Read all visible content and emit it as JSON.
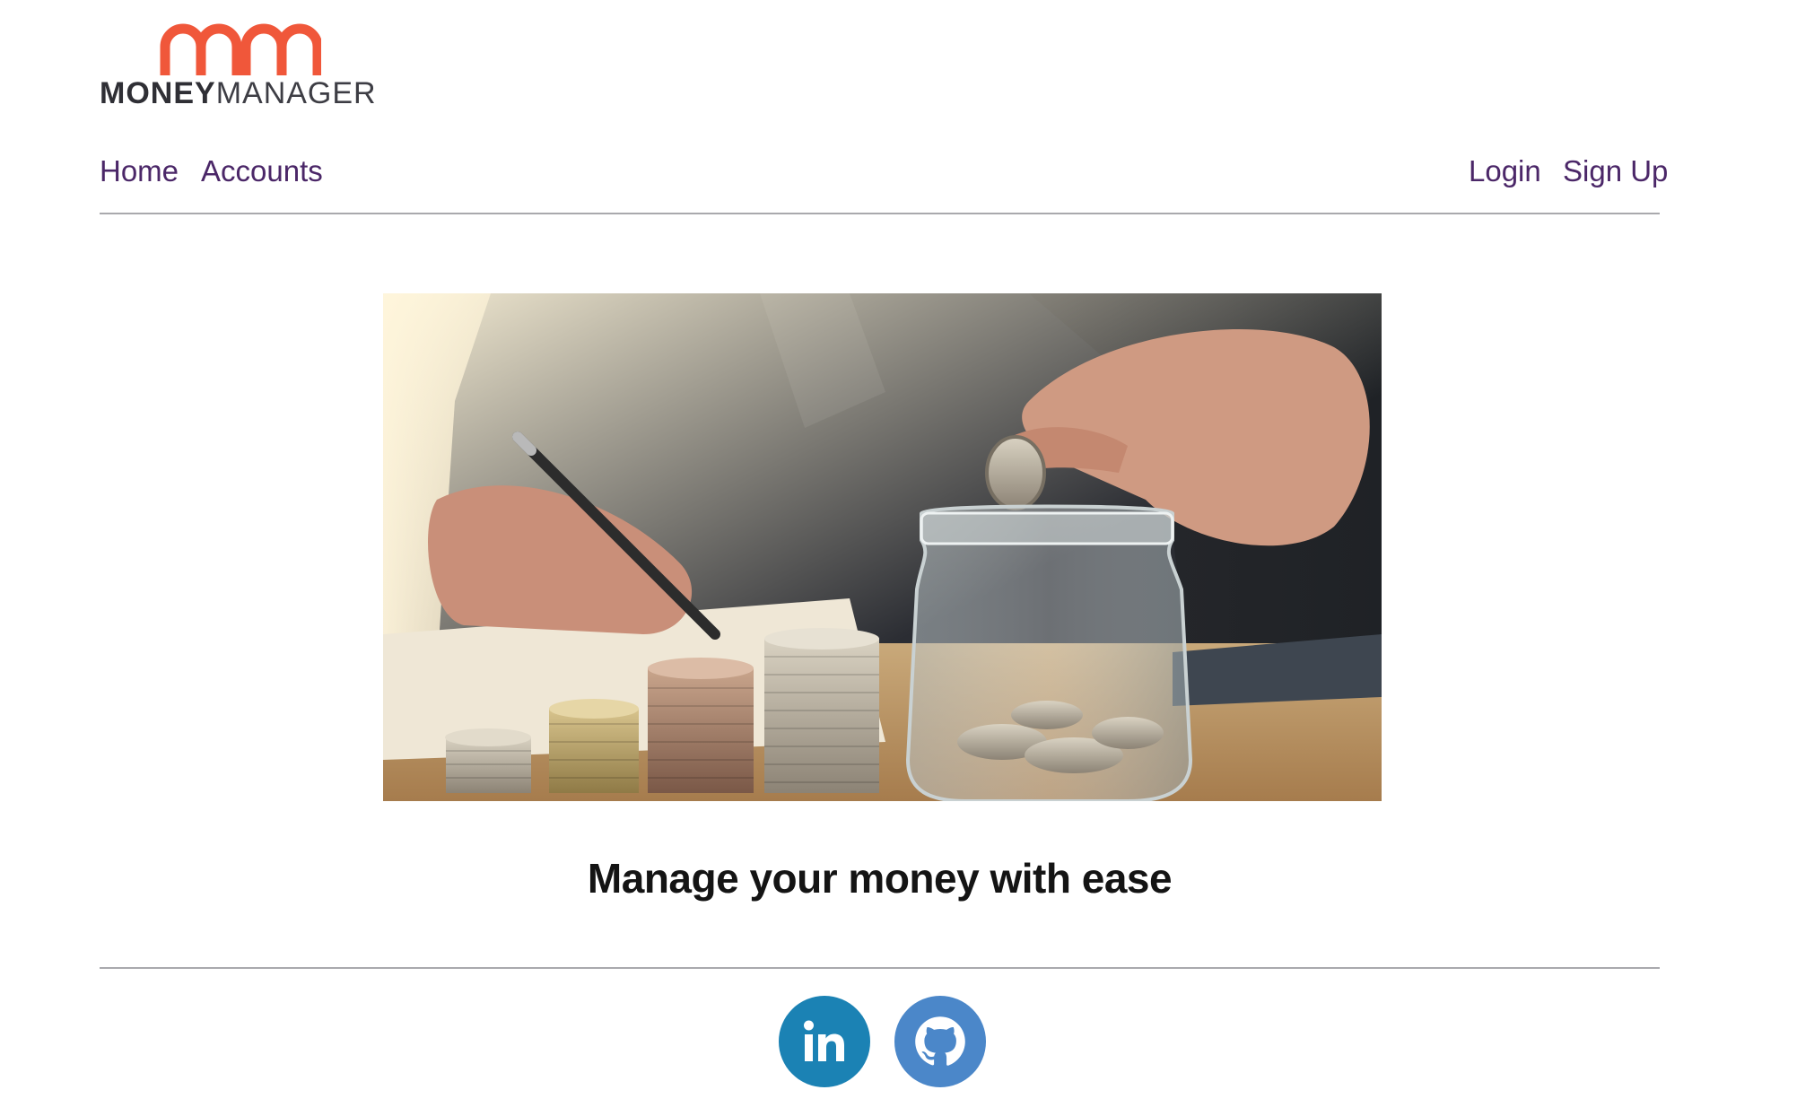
{
  "brand": {
    "logo_bold": "MONEY",
    "logo_light": "MANAGER",
    "accent_color": "#f0573a"
  },
  "nav": {
    "home": "Home",
    "accounts": "Accounts",
    "login": "Login",
    "signup": "Sign Up",
    "link_color": "#4b2768"
  },
  "hero": {
    "tagline": "Manage your money with ease"
  },
  "footer": {
    "linkedin_icon": "linkedin-icon",
    "github_icon": "github-icon",
    "linkedin_color": "#1b82b4",
    "github_color": "#4b87c9"
  }
}
